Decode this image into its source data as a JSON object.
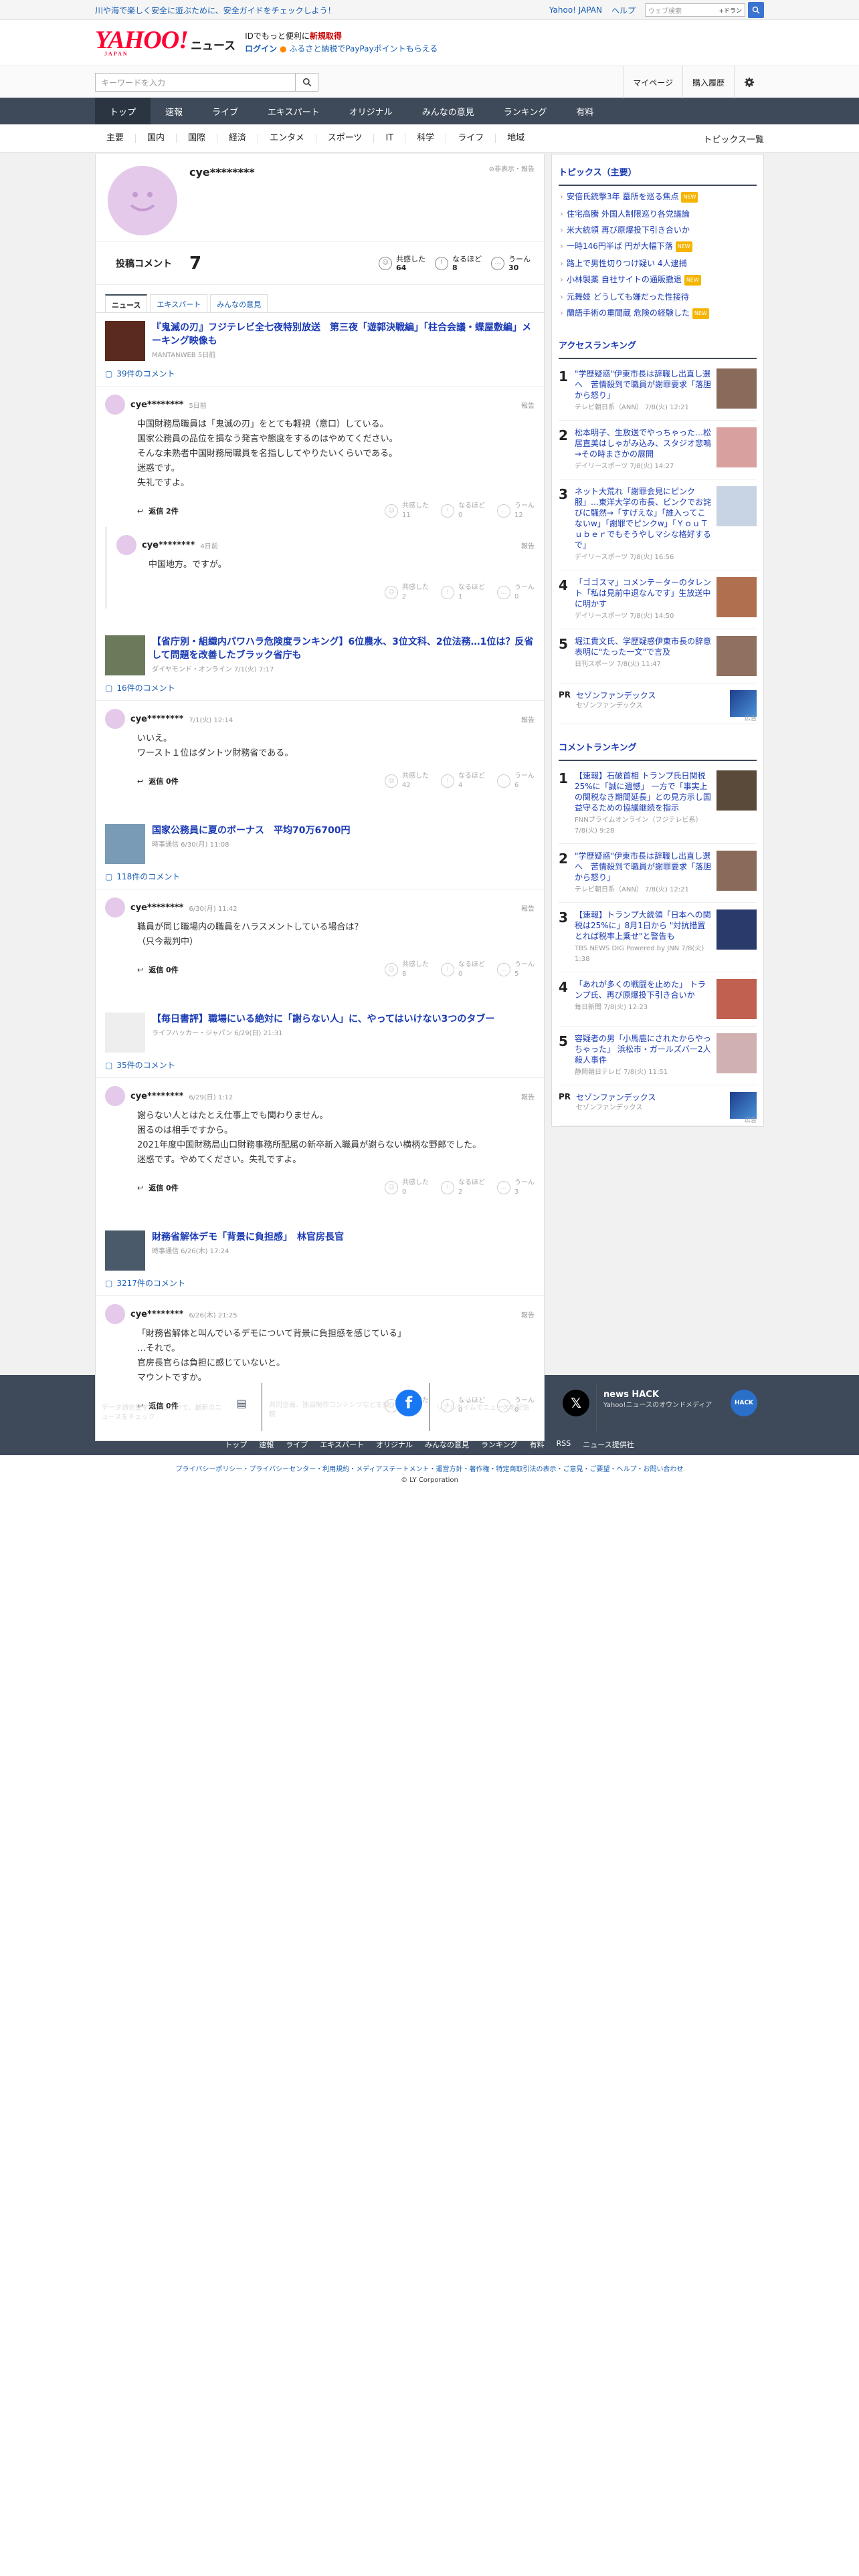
{
  "topbar": {
    "promo": "川や海で楽しく安全に遊ぶために、安全ガイドをチェックしよう！",
    "yahoo_japan": "Yahoo! JAPAN",
    "help": "ヘルプ",
    "web_search_placeholder": "ウェブ検索",
    "provider": "+ドラン"
  },
  "header": {
    "logo": "YAHOO!",
    "logo_sub": "JAPAN",
    "service": "ニュース",
    "tagline_pre": "IDでもっと便利に",
    "tagline_link": "新規取得",
    "login": "ログイン",
    "campaign": "ふるさと納税でPayPayポイントもらえる"
  },
  "search": {
    "placeholder": "キーワードを入力",
    "mypage": "マイページ",
    "history": "購入履歴"
  },
  "nav": [
    "トップ",
    "速報",
    "ライブ",
    "エキスパート",
    "オリジナル",
    "みんなの意見",
    "ランキング",
    "有料"
  ],
  "subnav": [
    "主要",
    "国内",
    "国際",
    "経済",
    "エンタメ",
    "スポーツ",
    "IT",
    "科学",
    "ライフ",
    "地域"
  ],
  "subnav_more": "トピックス一覧",
  "profile": {
    "name": "cye********",
    "hide": "非表示・報告",
    "label": "投稿コメント",
    "count": "7",
    "reactions": [
      {
        "label": "共感した",
        "value": "64"
      },
      {
        "label": "なるほど",
        "value": "8"
      },
      {
        "label": "うーん",
        "value": "30"
      }
    ]
  },
  "tabs": [
    "ニュース",
    "エキスパート",
    "みんなの意見"
  ],
  "reply_label": "返信",
  "report": "報告",
  "rx_labels": [
    "共感した",
    "なるほど",
    "うーん"
  ],
  "articles": [
    {
      "title": "『鬼滅の刃』フジテレビ全七夜特別放送　第三夜「遊郭決戦編」「柱合会議・蝶屋敷編」メーキング映像も",
      "source": "MANTANWEB 5日前",
      "comment_count": "39件のコメント",
      "comments": [
        {
          "user": "cye********",
          "date": "5日前",
          "text": "中国財務局職員は「鬼滅の刃」をとても軽視（意口）している。\n国家公務員の品位を損なう発言や態度をするのはやめてください。\nそんな未熟者中国財務局職員を名指ししてやりたいくらいである。\n迷惑です。\n失礼ですよ。",
          "reply": "返信 2件",
          "rx": [
            "11",
            "0",
            "12"
          ]
        },
        {
          "user": "cye********",
          "date": "4日前",
          "text": "中国地方。ですが。",
          "reply": "",
          "rx": [
            "2",
            "1",
            "0"
          ],
          "is_reply": true
        }
      ]
    },
    {
      "title": "【省庁別・組織内パワハラ危険度ランキング】6位農水、3位文科、2位法務…1位は？反省して問題を改善したブラック省庁も",
      "source": "ダイヤモンド・オンライン 7/1(火) 7:17",
      "comment_count": "16件のコメント",
      "comments": [
        {
          "user": "cye********",
          "date": "7/1(火) 12:14",
          "text": "いいえ。\nワースト１位はダントツ財務省である。",
          "reply": "返信 0件",
          "rx": [
            "42",
            "4",
            "6"
          ]
        }
      ]
    },
    {
      "title": "国家公務員に夏のボーナス　平均70万6700円",
      "source": "時事通信 6/30(月) 11:08",
      "comment_count": "118件のコメント",
      "comments": [
        {
          "user": "cye********",
          "date": "6/30(月) 11:42",
          "text": "職員が同じ職場内の職員をハラスメントしている場合は？\n（只今裁判中）",
          "reply": "返信 0件",
          "rx": [
            "8",
            "0",
            "5"
          ]
        }
      ]
    },
    {
      "title": "【毎日書評】職場にいる絶対に「謝らない人」に、やってはいけない3つのタブー",
      "source": "ライフハッカー・ジャパン 6/29(日) 21:31",
      "comment_count": "35件のコメント",
      "comments": [
        {
          "user": "cye********",
          "date": "6/29(日) 1:12",
          "text": "謝らない人とはたとえ仕事上でも関わりません。\n困るのは相手ですから。\n2021年度中国財務局山口財務事務所配属の新卒新入職員が謝らない横柄な野郎でした。\n迷惑です。やめてください。失礼ですよ。",
          "reply": "返信 0件",
          "rx": [
            "0",
            "2",
            "3"
          ]
        }
      ]
    },
    {
      "title": "財務省解体デモ「背景に負担感」　林官房長官",
      "source": "時事通信 6/26(木) 17:24",
      "comment_count": "3217件のコメント",
      "comments": [
        {
          "user": "cye********",
          "date": "6/26(木) 21:25",
          "text": "「財務省解体と叫んでいるデモについて背景に負担感を感じている」\n…それで。\n官房長官らは負担に感じていないと。\nマウントですか。",
          "reply": "返信 0件",
          "rx": [
            "1",
            "0",
            "0"
          ]
        }
      ]
    }
  ],
  "side": {
    "topics_title": "トピックス（主要）",
    "topics": [
      {
        "t": "安倍氏銃撃3年 墓所を巡る焦点",
        "b": "NEW"
      },
      {
        "t": "住宅高騰 外国人制限巡り各党議論",
        "b": ""
      },
      {
        "t": "米大統領 再び原爆投下引き合いか",
        "b": ""
      },
      {
        "t": "一時146円半ば 円が大幅下落",
        "b": "NEW"
      },
      {
        "t": "路上で男性切りつけ疑い 4人逮捕",
        "b": ""
      },
      {
        "t": "小林製薬 自社サイトの通販撤退",
        "b": "NEW"
      },
      {
        "t": "元舞妓 どうしても嫌だった性接待",
        "b": ""
      },
      {
        "t": "蘭語手術の重間蔵 危険の経験した",
        "b": "NEW"
      }
    ],
    "access_title": "アクセスランキング",
    "access": [
      {
        "n": "1",
        "t": "\"学歴疑惑\"伊東市長は辞職し出直し選へ　苦情殺到で職員が謝罪要求「落胆から怒り」",
        "s": "テレビ朝日系（ANN） 7/8(火) 12:21"
      },
      {
        "n": "2",
        "t": "松本明子、生放送でやっちゃった…松居直美はしゃがみ込み、スタジオ悲鳴→その時まさかの展開",
        "s": "デイリースポーツ 7/8(火) 14:27"
      },
      {
        "n": "3",
        "t": "ネット大荒れ「謝罪会見にピンク服」…東洋大学の市長、ピンクでお詫びに騒然→「すげえな」「誰入ってこないw」「謝罪でピンクw」「ＹｏｕＴｕｂｅｒでもそうやしマシな格好するで」",
        "s": "デイリースポーツ 7/8(火) 16:56"
      },
      {
        "n": "4",
        "t": "「ゴゴスマ」コメンテーターのタレント「私は見前中退なんです」生放送中に明かす",
        "s": "デイリースポーツ 7/8(火) 14:50"
      },
      {
        "n": "5",
        "t": "堀江貴文氏、学歴疑惑伊東市長の辞意表明に\"たった一文\"で言及",
        "s": "日刊スポーツ 7/8(火) 11:47"
      }
    ],
    "pr1": {
      "label": "PR",
      "t": "セゾンファンデックス",
      "s": "セゾンファンデックス",
      "ad": "広告"
    },
    "comment_title": "コメントランキング",
    "comment_rank": [
      {
        "n": "1",
        "t": "【速報】石破首相 トランプ氏日関税25%に「誠に遺憾」 一方で「事実上の関税なき期間延長」との見方示し国益守るための協議継続を指示",
        "s": "FNNプライムオンライン（フジテレビ系） 7/8(火) 9:28"
      },
      {
        "n": "2",
        "t": "\"学歴疑惑\"伊東市長は辞職し出直し選へ　苦情殺到で職員が謝罪要求「落胆から怒り」",
        "s": "テレビ朝日系（ANN） 7/8(火) 12:21"
      },
      {
        "n": "3",
        "t": "【速報】トランプ大統領「日本への関税は25%に」8月1日から \"対抗措置とれば税率上乗せ\"と警告も",
        "s": "TBS NEWS DIG Powered by JNN 7/8(火) 1:38"
      },
      {
        "n": "4",
        "t": "「あれが多くの戦闘を止めた」 トランプ氏、再び原爆投下引き合いか",
        "s": "毎日新聞 7/8(火) 12:23"
      },
      {
        "n": "5",
        "t": "容疑者の男「小馬鹿にされたからやっちゃった」 浜松市・ガールズバー2人殺人事件",
        "s": "静岡朝日テレビ 7/8(火) 11:51"
      }
    ],
    "pr2": {
      "label": "PR",
      "t": "セゾンファンデックス",
      "s": "セゾンファンデックス",
      "ad": "広告"
    }
  },
  "footer": {
    "cards": [
      {
        "t": "アプリ",
        "d": "データ通信量を気にしないで、最新のニュースをチェック"
      },
      {
        "t": "Facebook",
        "d": "共同企画、独自制作コンテンツなどを投稿"
      },
      {
        "t": "X（旧Twitter）",
        "d": "リアルタイムでニュースを配信"
      },
      {
        "t": "news HACK",
        "d": "Yahoo!ニュースのオウンドメディア"
      }
    ],
    "links": [
      "トップ",
      "速報",
      "ライブ",
      "エキスパート",
      "オリジナル",
      "みんなの意見",
      "ランキング",
      "有料",
      "RSS",
      "ニュース提供社"
    ],
    "legal": "プライバシーポリシー・プライバシーセンター・利用規約・メディアステートメント・運営方針・著作権・特定商取引法の表示・ご意見・ご要望・ヘルプ・お問い合わせ",
    "copyright": "© LY Corporation"
  }
}
